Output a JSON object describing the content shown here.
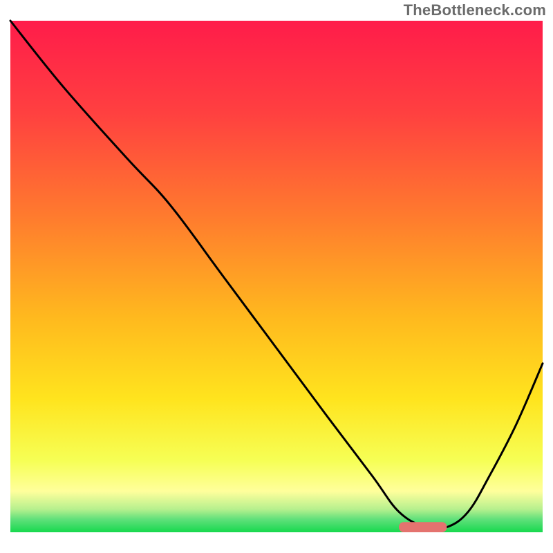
{
  "watermark": "TheBottleneck.com",
  "chart_data": {
    "type": "line",
    "title": "",
    "xlabel": "",
    "ylabel": "",
    "xlim": [
      0,
      100
    ],
    "ylim": [
      0,
      100
    ],
    "grid": false,
    "legend": false,
    "annotations": [],
    "background": {
      "type": "vertical-gradient",
      "description": "Vertical color gradient from red at top through orange, yellow, pale-green to bright green at bottom, indicating high-to-low bottleneck severity.",
      "stops": [
        {
          "pos": 0.0,
          "color": "#ff1c4a"
        },
        {
          "pos": 0.18,
          "color": "#ff4040"
        },
        {
          "pos": 0.38,
          "color": "#ff7a2e"
        },
        {
          "pos": 0.58,
          "color": "#ffb91e"
        },
        {
          "pos": 0.74,
          "color": "#ffe41e"
        },
        {
          "pos": 0.86,
          "color": "#f6ff55"
        },
        {
          "pos": 0.92,
          "color": "#ffff9c"
        },
        {
          "pos": 0.955,
          "color": "#b6f08e"
        },
        {
          "pos": 0.975,
          "color": "#5fe07a"
        },
        {
          "pos": 1.0,
          "color": "#17d94e"
        }
      ]
    },
    "series": [
      {
        "name": "bottleneck-curve",
        "color": "#000000",
        "x": [
          0,
          10,
          22,
          30,
          40,
          50,
          60,
          68,
          73,
          78,
          82,
          86,
          90,
          95,
          100
        ],
        "values": [
          100,
          87,
          73,
          64,
          50,
          36,
          22,
          11,
          4,
          1,
          1,
          4,
          11,
          21,
          33
        ]
      }
    ],
    "markers": [
      {
        "name": "optimal-range-marker",
        "shape": "rounded-bar",
        "color": "#e4736f",
        "x_start": 73,
        "x_end": 82,
        "y": 1,
        "height": 2.0
      }
    ]
  }
}
